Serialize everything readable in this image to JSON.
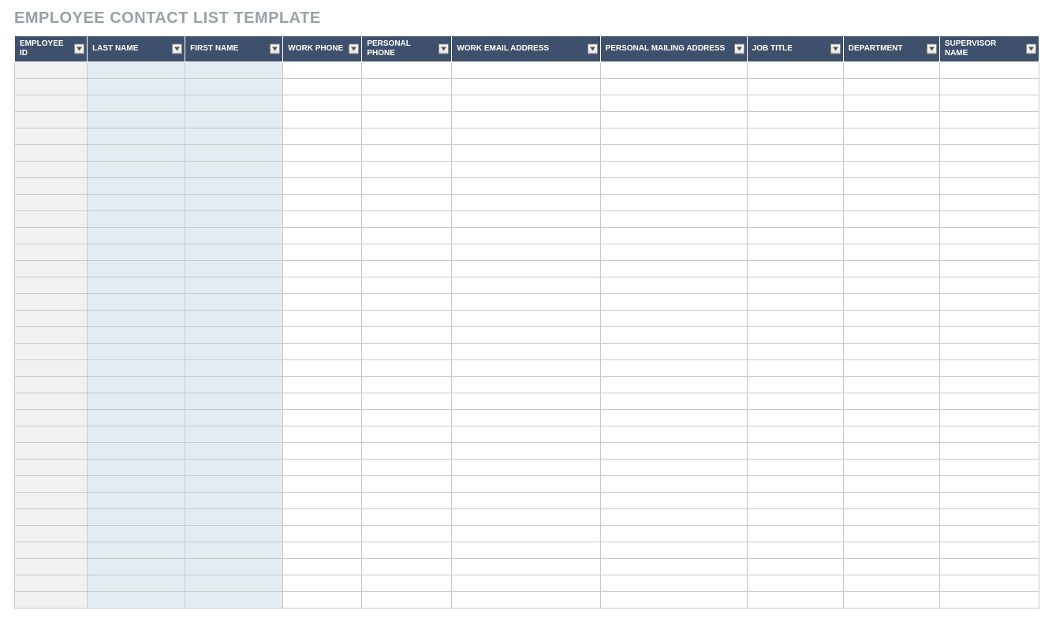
{
  "title": "EMPLOYEE CONTACT LIST TEMPLATE",
  "columns": [
    {
      "label": "EMPLOYEE ID"
    },
    {
      "label": "LAST NAME"
    },
    {
      "label": "FIRST NAME"
    },
    {
      "label": "WORK PHONE"
    },
    {
      "label": "PERSONAL PHONE"
    },
    {
      "label": "WORK EMAIL ADDRESS"
    },
    {
      "label": "PERSONAL MAILING ADDRESS"
    },
    {
      "label": "JOB TITLE"
    },
    {
      "label": "DEPARTMENT"
    },
    {
      "label": "SUPERVISOR NAME"
    }
  ],
  "rows": [
    [
      "",
      "",
      "",
      "",
      "",
      "",
      "",
      "",
      "",
      ""
    ],
    [
      "",
      "",
      "",
      "",
      "",
      "",
      "",
      "",
      "",
      ""
    ],
    [
      "",
      "",
      "",
      "",
      "",
      "",
      "",
      "",
      "",
      ""
    ],
    [
      "",
      "",
      "",
      "",
      "",
      "",
      "",
      "",
      "",
      ""
    ],
    [
      "",
      "",
      "",
      "",
      "",
      "",
      "",
      "",
      "",
      ""
    ],
    [
      "",
      "",
      "",
      "",
      "",
      "",
      "",
      "",
      "",
      ""
    ],
    [
      "",
      "",
      "",
      "",
      "",
      "",
      "",
      "",
      "",
      ""
    ],
    [
      "",
      "",
      "",
      "",
      "",
      "",
      "",
      "",
      "",
      ""
    ],
    [
      "",
      "",
      "",
      "",
      "",
      "",
      "",
      "",
      "",
      ""
    ],
    [
      "",
      "",
      "",
      "",
      "",
      "",
      "",
      "",
      "",
      ""
    ],
    [
      "",
      "",
      "",
      "",
      "",
      "",
      "",
      "",
      "",
      ""
    ],
    [
      "",
      "",
      "",
      "",
      "",
      "",
      "",
      "",
      "",
      ""
    ],
    [
      "",
      "",
      "",
      "",
      "",
      "",
      "",
      "",
      "",
      ""
    ],
    [
      "",
      "",
      "",
      "",
      "",
      "",
      "",
      "",
      "",
      ""
    ],
    [
      "",
      "",
      "",
      "",
      "",
      "",
      "",
      "",
      "",
      ""
    ],
    [
      "",
      "",
      "",
      "",
      "",
      "",
      "",
      "",
      "",
      ""
    ],
    [
      "",
      "",
      "",
      "",
      "",
      "",
      "",
      "",
      "",
      ""
    ],
    [
      "",
      "",
      "",
      "",
      "",
      "",
      "",
      "",
      "",
      ""
    ],
    [
      "",
      "",
      "",
      "",
      "",
      "",
      "",
      "",
      "",
      ""
    ],
    [
      "",
      "",
      "",
      "",
      "",
      "",
      "",
      "",
      "",
      ""
    ],
    [
      "",
      "",
      "",
      "",
      "",
      "",
      "",
      "",
      "",
      ""
    ],
    [
      "",
      "",
      "",
      "",
      "",
      "",
      "",
      "",
      "",
      ""
    ],
    [
      "",
      "",
      "",
      "",
      "",
      "",
      "",
      "",
      "",
      ""
    ],
    [
      "",
      "",
      "",
      "",
      "",
      "",
      "",
      "",
      "",
      ""
    ],
    [
      "",
      "",
      "",
      "",
      "",
      "",
      "",
      "",
      "",
      ""
    ],
    [
      "",
      "",
      "",
      "",
      "",
      "",
      "",
      "",
      "",
      ""
    ],
    [
      "",
      "",
      "",
      "",
      "",
      "",
      "",
      "",
      "",
      ""
    ],
    [
      "",
      "",
      "",
      "",
      "",
      "",
      "",
      "",
      "",
      ""
    ],
    [
      "",
      "",
      "",
      "",
      "",
      "",
      "",
      "",
      "",
      ""
    ],
    [
      "",
      "",
      "",
      "",
      "",
      "",
      "",
      "",
      "",
      ""
    ],
    [
      "",
      "",
      "",
      "",
      "",
      "",
      "",
      "",
      "",
      ""
    ],
    [
      "",
      "",
      "",
      "",
      "",
      "",
      "",
      "",
      "",
      ""
    ],
    [
      "",
      "",
      "",
      "",
      "",
      "",
      "",
      "",
      "",
      ""
    ]
  ],
  "colors": {
    "header_bg": "#3e506b",
    "title_color": "#9aa0a6",
    "shaded_id": "#f1f1f1",
    "shaded_name": "#e5ebf2"
  }
}
